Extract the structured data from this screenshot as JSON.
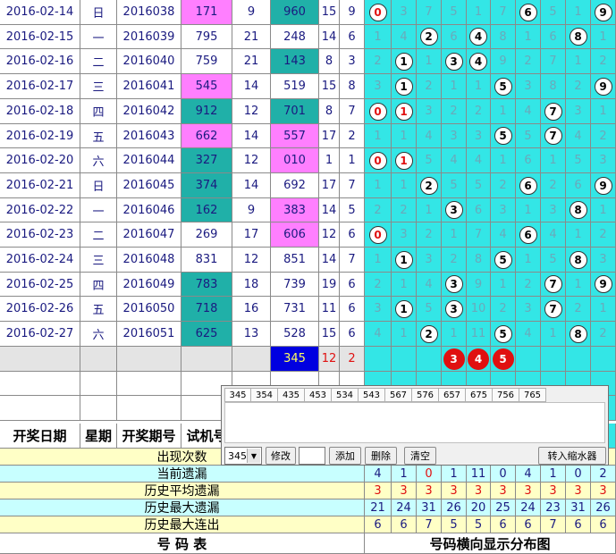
{
  "rows": [
    {
      "date": "2016-02-14",
      "weekday": "日",
      "issue": "2016038",
      "test": "171",
      "test_sum": "9",
      "draw": "960",
      "draw_sum": "15",
      "draw_span": "9",
      "dist": [
        "0",
        "3",
        "7",
        "5",
        "1",
        "7",
        "6",
        "5",
        "1",
        "9"
      ],
      "balls": [
        0,
        6,
        9
      ],
      "test_bg": "pink",
      "draw_bg": "teal"
    },
    {
      "date": "2016-02-15",
      "weekday": "一",
      "issue": "2016039",
      "test": "795",
      "test_sum": "21",
      "draw": "248",
      "draw_sum": "14",
      "draw_span": "6",
      "dist": [
        "1",
        "4",
        "2",
        "6",
        "4",
        "8",
        "1",
        "6",
        "8",
        "1"
      ],
      "balls": [
        2,
        4,
        8
      ],
      "test_bg": "",
      "draw_bg": ""
    },
    {
      "date": "2016-02-16",
      "weekday": "二",
      "issue": "2016040",
      "test": "759",
      "test_sum": "21",
      "draw": "143",
      "draw_sum": "8",
      "draw_span": "3",
      "dist": [
        "2",
        "1",
        "1",
        "3",
        "4",
        "9",
        "2",
        "7",
        "1",
        "2"
      ],
      "balls": [
        1,
        3,
        4
      ],
      "test_bg": "",
      "draw_bg": "teal"
    },
    {
      "date": "2016-02-17",
      "weekday": "三",
      "issue": "2016041",
      "test": "545",
      "test_sum": "14",
      "draw": "519",
      "draw_sum": "15",
      "draw_span": "8",
      "dist": [
        "3",
        "1",
        "2",
        "1",
        "1",
        "5",
        "3",
        "8",
        "2",
        "9"
      ],
      "balls": [
        1,
        5,
        9
      ],
      "test_bg": "pink",
      "draw_bg": ""
    },
    {
      "date": "2016-02-18",
      "weekday": "四",
      "issue": "2016042",
      "test": "912",
      "test_sum": "12",
      "draw": "701",
      "draw_sum": "8",
      "draw_span": "7",
      "dist": [
        "0",
        "1",
        "3",
        "2",
        "2",
        "1",
        "4",
        "7",
        "3",
        "1"
      ],
      "balls": [
        0,
        1,
        7
      ],
      "test_bg": "teal",
      "draw_bg": "teal"
    },
    {
      "date": "2016-02-19",
      "weekday": "五",
      "issue": "2016043",
      "test": "662",
      "test_sum": "14",
      "draw": "557",
      "draw_sum": "17",
      "draw_span": "2",
      "dist": [
        "1",
        "1",
        "4",
        "3",
        "3",
        "5",
        "5",
        "7",
        "4",
        "2"
      ],
      "balls": [
        5,
        7
      ],
      "test_bg": "pink",
      "draw_bg": "pink"
    },
    {
      "date": "2016-02-20",
      "weekday": "六",
      "issue": "2016044",
      "test": "327",
      "test_sum": "12",
      "draw": "010",
      "draw_sum": "1",
      "draw_span": "1",
      "dist": [
        "0",
        "1",
        "5",
        "4",
        "4",
        "1",
        "6",
        "1",
        "5",
        "3"
      ],
      "balls": [
        0,
        1
      ],
      "test_bg": "teal",
      "draw_bg": "pink"
    },
    {
      "date": "2016-02-21",
      "weekday": "日",
      "issue": "2016045",
      "test": "374",
      "test_sum": "14",
      "draw": "692",
      "draw_sum": "17",
      "draw_span": "7",
      "dist": [
        "1",
        "1",
        "2",
        "5",
        "5",
        "2",
        "6",
        "2",
        "6",
        "9"
      ],
      "balls": [
        2,
        6,
        9
      ],
      "test_bg": "teal",
      "draw_bg": ""
    },
    {
      "date": "2016-02-22",
      "weekday": "一",
      "issue": "2016046",
      "test": "162",
      "test_sum": "9",
      "draw": "383",
      "draw_sum": "14",
      "draw_span": "5",
      "dist": [
        "2",
        "2",
        "1",
        "3",
        "6",
        "3",
        "1",
        "3",
        "8",
        "1"
      ],
      "balls": [
        3,
        8
      ],
      "test_bg": "teal",
      "draw_bg": "pink"
    },
    {
      "date": "2016-02-23",
      "weekday": "二",
      "issue": "2016047",
      "test": "269",
      "test_sum": "17",
      "draw": "606",
      "draw_sum": "12",
      "draw_span": "6",
      "dist": [
        "0",
        "3",
        "2",
        "1",
        "7",
        "4",
        "6",
        "4",
        "1",
        "2"
      ],
      "balls": [
        0,
        6
      ],
      "test_bg": "",
      "draw_bg": "pink"
    },
    {
      "date": "2016-02-24",
      "weekday": "三",
      "issue": "2016048",
      "test": "831",
      "test_sum": "12",
      "draw": "851",
      "draw_sum": "14",
      "draw_span": "7",
      "dist": [
        "1",
        "1",
        "3",
        "2",
        "8",
        "5",
        "1",
        "5",
        "8",
        "3"
      ],
      "balls": [
        1,
        5,
        8
      ],
      "test_bg": "",
      "draw_bg": ""
    },
    {
      "date": "2016-02-25",
      "weekday": "四",
      "issue": "2016049",
      "test": "783",
      "test_sum": "18",
      "draw": "739",
      "draw_sum": "19",
      "draw_span": "6",
      "dist": [
        "2",
        "1",
        "4",
        "3",
        "9",
        "1",
        "2",
        "7",
        "1",
        "9"
      ],
      "balls": [
        3,
        7,
        9
      ],
      "test_bg": "teal",
      "draw_bg": ""
    },
    {
      "date": "2016-02-26",
      "weekday": "五",
      "issue": "2016050",
      "test": "718",
      "test_sum": "16",
      "draw": "731",
      "draw_sum": "11",
      "draw_span": "6",
      "dist": [
        "3",
        "1",
        "5",
        "3",
        "10",
        "2",
        "3",
        "7",
        "2",
        "1"
      ],
      "balls": [
        1,
        3,
        7
      ],
      "test_bg": "teal",
      "draw_bg": ""
    },
    {
      "date": "2016-02-27",
      "weekday": "六",
      "issue": "2016051",
      "test": "625",
      "test_sum": "13",
      "draw": "528",
      "draw_sum": "15",
      "draw_span": "6",
      "dist": [
        "4",
        "1",
        "2",
        "1",
        "11",
        "5",
        "4",
        "1",
        "8",
        "2"
      ],
      "balls": [
        2,
        5,
        8
      ],
      "test_bg": "teal",
      "draw_bg": ""
    }
  ],
  "current": {
    "draw": "345",
    "sum": "12",
    "span": "2",
    "balls": [
      "3",
      "4",
      "5"
    ]
  },
  "header": {
    "date": "开奖日期",
    "weekday": "星期",
    "issue": "开奖期号",
    "test": "试机号"
  },
  "stats": [
    {
      "label": "出现次数",
      "values": [
        "",
        "",
        "",
        "",
        "",
        "",
        "",
        "",
        "",
        ""
      ],
      "bg": "yellow"
    },
    {
      "label": "当前遗漏",
      "values": [
        "4",
        "1",
        "0",
        "1",
        "11",
        "0",
        "4",
        "1",
        "0",
        "2"
      ],
      "bg": "cyan",
      "red_index": 2
    },
    {
      "label": "历史平均遗漏",
      "values": [
        "3",
        "3",
        "3",
        "3",
        "3",
        "3",
        "3",
        "3",
        "3",
        "3"
      ],
      "bg": "yellow",
      "red_all": true
    },
    {
      "label": "历史最大遗漏",
      "values": [
        "21",
        "24",
        "31",
        "26",
        "20",
        "25",
        "24",
        "23",
        "31",
        "26"
      ],
      "bg": "cyan"
    },
    {
      "label": "历史最大连出",
      "values": [
        "6",
        "6",
        "7",
        "5",
        "5",
        "6",
        "6",
        "7",
        "6",
        "6"
      ],
      "bg": "yellow"
    }
  ],
  "footer": {
    "left": "号 码 表",
    "right": "号码横向显示分布图"
  },
  "popup": {
    "tabs": [
      "345",
      "354",
      "435",
      "453",
      "534",
      "543",
      "567",
      "576",
      "657",
      "675",
      "756",
      "765"
    ],
    "select_value": "345",
    "btn_edit": "修改",
    "btn_add": "添加",
    "btn_delete": "删除",
    "btn_clear": "清空",
    "btn_shrink": "转入缩水器"
  },
  "colors": {
    "pink": "#ff7fff",
    "teal": "#20b0a8",
    "cyan": "#33e6e6",
    "red": "#e01010",
    "blue": "#0000e0"
  }
}
